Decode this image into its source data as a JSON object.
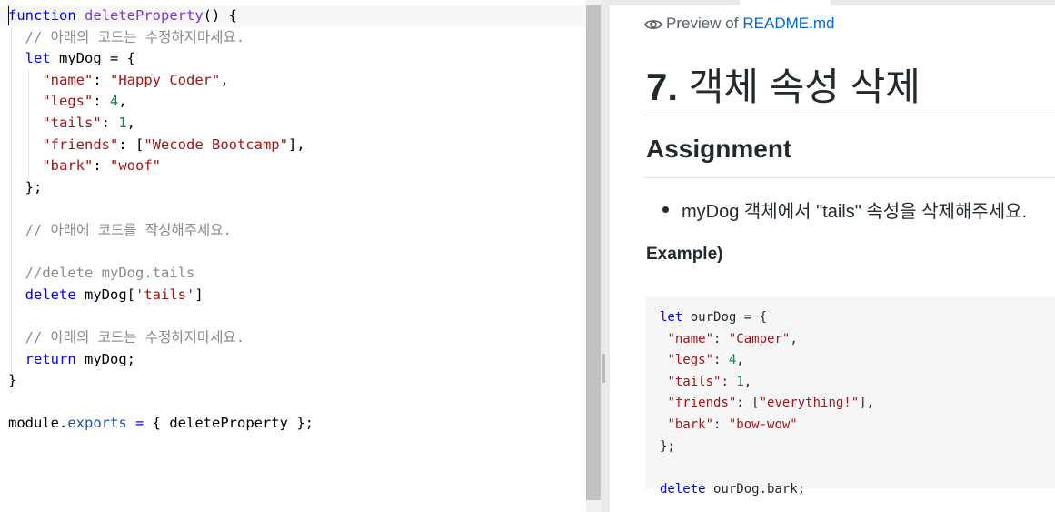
{
  "editor": {
    "code_lines": [
      [
        {
          "t": "function",
          "c": "kw"
        },
        {
          "t": " "
        },
        {
          "t": "deleteProperty",
          "c": "fnname"
        },
        {
          "t": "() {"
        }
      ],
      [
        {
          "t": "  "
        },
        {
          "t": "// 아래의 코드는 수정하지마세요.",
          "c": "cmt"
        }
      ],
      [
        {
          "t": "  "
        },
        {
          "t": "let",
          "c": "kw"
        },
        {
          "t": " myDog = {"
        }
      ],
      [
        {
          "t": "    "
        },
        {
          "t": "\"name\"",
          "c": "str"
        },
        {
          "t": ": "
        },
        {
          "t": "\"Happy Coder\"",
          "c": "str"
        },
        {
          "t": ","
        }
      ],
      [
        {
          "t": "    "
        },
        {
          "t": "\"legs\"",
          "c": "str"
        },
        {
          "t": ": "
        },
        {
          "t": "4",
          "c": "num"
        },
        {
          "t": ","
        }
      ],
      [
        {
          "t": "    "
        },
        {
          "t": "\"tails\"",
          "c": "str"
        },
        {
          "t": ": "
        },
        {
          "t": "1",
          "c": "num"
        },
        {
          "t": ","
        }
      ],
      [
        {
          "t": "    "
        },
        {
          "t": "\"friends\"",
          "c": "str"
        },
        {
          "t": ": ["
        },
        {
          "t": "\"Wecode Bootcamp\"",
          "c": "str"
        },
        {
          "t": "],"
        }
      ],
      [
        {
          "t": "    "
        },
        {
          "t": "\"bark\"",
          "c": "str"
        },
        {
          "t": ": "
        },
        {
          "t": "\"woof\"",
          "c": "str"
        }
      ],
      [
        {
          "t": "  };"
        }
      ],
      [
        {
          "t": ""
        }
      ],
      [
        {
          "t": "  "
        },
        {
          "t": "// 아래에 코드를 작성해주세요.",
          "c": "cmt"
        }
      ],
      [
        {
          "t": ""
        }
      ],
      [
        {
          "t": "  "
        },
        {
          "t": "//delete myDog.tails",
          "c": "cmt"
        }
      ],
      [
        {
          "t": "  "
        },
        {
          "t": "delete",
          "c": "kw"
        },
        {
          "t": " myDog["
        },
        {
          "t": "'tails'",
          "c": "str"
        },
        {
          "t": "]"
        }
      ],
      [
        {
          "t": ""
        }
      ],
      [
        {
          "t": "  "
        },
        {
          "t": "// 아래의 코드는 수정하지마세요.",
          "c": "cmt"
        }
      ],
      [
        {
          "t": "  "
        },
        {
          "t": "return",
          "c": "kw"
        },
        {
          "t": " myDog;"
        }
      ],
      [
        {
          "t": "}"
        }
      ],
      [
        {
          "t": ""
        }
      ],
      [
        {
          "t": "module."
        },
        {
          "t": "exports",
          "c": "prop"
        },
        {
          "t": " "
        },
        {
          "t": "=",
          "c": "kw"
        },
        {
          "t": " { deleteProperty };"
        }
      ]
    ]
  },
  "preview": {
    "header_prefix": "Preview of",
    "file_name": "README.md",
    "title_number": "7.",
    "title_text": "객체 속성 삭제",
    "section_heading": "Assignment",
    "bullet_text": "myDog 객체에서 \"tails\" 속성을 삭제해주세요.",
    "example_label": "Example)",
    "example_lines": [
      [
        {
          "t": "let",
          "c": "kw"
        },
        {
          "t": " ourDog = {"
        }
      ],
      [
        {
          "t": " "
        },
        {
          "t": "\"name\"",
          "c": "str"
        },
        {
          "t": ": "
        },
        {
          "t": "\"Camper\"",
          "c": "str"
        },
        {
          "t": ","
        }
      ],
      [
        {
          "t": " "
        },
        {
          "t": "\"legs\"",
          "c": "str"
        },
        {
          "t": ": "
        },
        {
          "t": "4",
          "c": "num"
        },
        {
          "t": ","
        }
      ],
      [
        {
          "t": " "
        },
        {
          "t": "\"tails\"",
          "c": "str"
        },
        {
          "t": ": "
        },
        {
          "t": "1",
          "c": "num"
        },
        {
          "t": ","
        }
      ],
      [
        {
          "t": " "
        },
        {
          "t": "\"friends\"",
          "c": "str"
        },
        {
          "t": ": ["
        },
        {
          "t": "\"everything!\"",
          "c": "str"
        },
        {
          "t": "],"
        }
      ],
      [
        {
          "t": " "
        },
        {
          "t": "\"bark\"",
          "c": "str"
        },
        {
          "t": ": "
        },
        {
          "t": "\"bow-wow\"",
          "c": "str"
        }
      ],
      [
        {
          "t": "};"
        }
      ],
      [
        {
          "t": ""
        }
      ],
      [
        {
          "t": "delete",
          "c": "kw"
        },
        {
          "t": " ourDog.bark;"
        }
      ]
    ]
  },
  "icons": {
    "preview": "eye-icon"
  }
}
